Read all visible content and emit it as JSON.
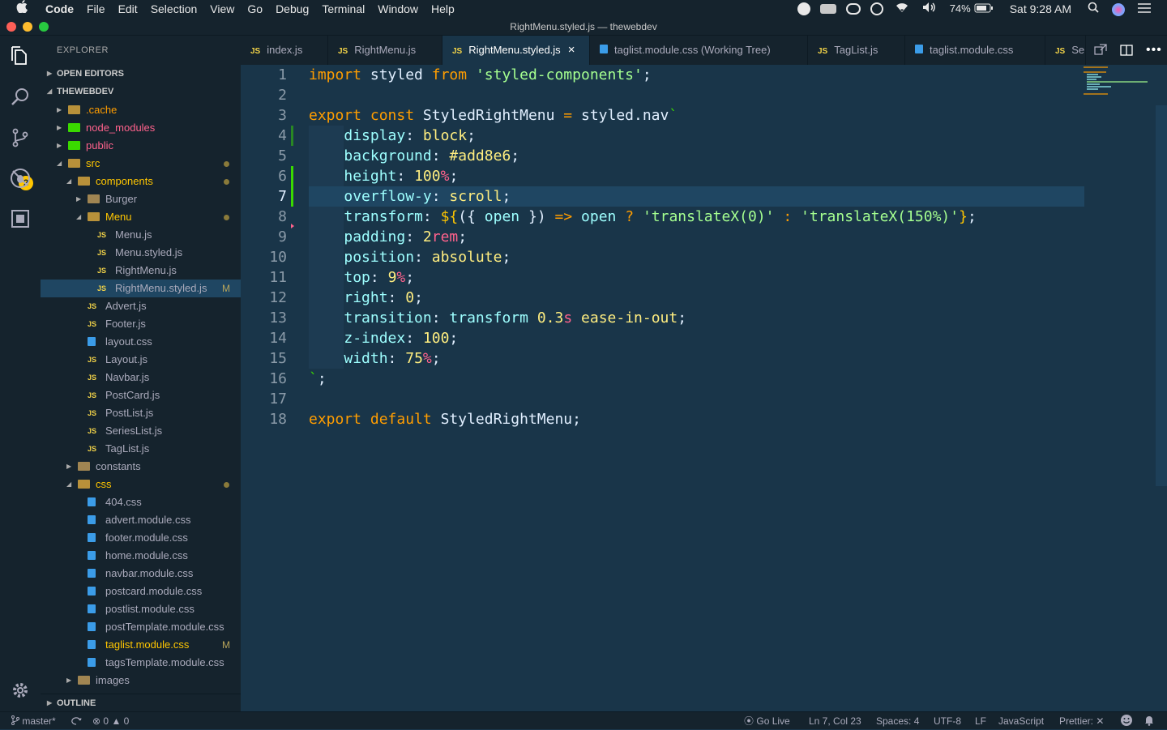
{
  "menubar": {
    "apple": "",
    "app": "Code",
    "items": [
      "File",
      "Edit",
      "Selection",
      "View",
      "Go",
      "Debug",
      "Terminal",
      "Window",
      "Help"
    ],
    "battery": "74%",
    "clock": "Sat 9:28 AM"
  },
  "window": {
    "title": "RightMenu.styled.js — thewebdev"
  },
  "activity": {
    "scm_badge": "2"
  },
  "sidebar": {
    "header": "EXPLORER",
    "open_editors": "OPEN EDITORS",
    "project": "THEWEBDEV",
    "outline": "OUTLINE",
    "tree": [
      {
        "name": ".cache",
        "kind": "folder",
        "color": "#ff9d00"
      },
      {
        "name": "node_modules",
        "kind": "folder",
        "color": "#ff628c"
      },
      {
        "name": "public",
        "kind": "folder",
        "color": "#ff628c"
      },
      {
        "name": "src",
        "kind": "folder",
        "color": "#ffc600"
      },
      {
        "name": "components",
        "kind": "folder",
        "color": "#ffc600"
      },
      {
        "name": "Burger",
        "kind": "folder",
        "color": "#aab"
      },
      {
        "name": "Menu",
        "kind": "folder",
        "color": "#ffc600"
      },
      {
        "name": "Menu.js",
        "kind": "js"
      },
      {
        "name": "Menu.styled.js",
        "kind": "js"
      },
      {
        "name": "RightMenu.js",
        "kind": "js"
      },
      {
        "name": "RightMenu.styled.js",
        "kind": "js",
        "modified": "M"
      },
      {
        "name": "Advert.js",
        "kind": "js"
      },
      {
        "name": "Footer.js",
        "kind": "js"
      },
      {
        "name": "layout.css",
        "kind": "css"
      },
      {
        "name": "Layout.js",
        "kind": "js"
      },
      {
        "name": "Navbar.js",
        "kind": "js"
      },
      {
        "name": "PostCard.js",
        "kind": "js"
      },
      {
        "name": "PostList.js",
        "kind": "js"
      },
      {
        "name": "SeriesList.js",
        "kind": "js"
      },
      {
        "name": "TagList.js",
        "kind": "js"
      },
      {
        "name": "constants",
        "kind": "folder"
      },
      {
        "name": "css",
        "kind": "folder",
        "color": "#ffc600"
      },
      {
        "name": "404.css",
        "kind": "css"
      },
      {
        "name": "advert.module.css",
        "kind": "css"
      },
      {
        "name": "footer.module.css",
        "kind": "css"
      },
      {
        "name": "home.module.css",
        "kind": "css"
      },
      {
        "name": "navbar.module.css",
        "kind": "css"
      },
      {
        "name": "postcard.module.css",
        "kind": "css"
      },
      {
        "name": "postlist.module.css",
        "kind": "css"
      },
      {
        "name": "postTemplate.module.css",
        "kind": "css"
      },
      {
        "name": "taglist.module.css",
        "kind": "css",
        "modified": "M",
        "color": "#ffc600"
      },
      {
        "name": "tagsTemplate.module.css",
        "kind": "css"
      },
      {
        "name": "images",
        "kind": "folder"
      }
    ]
  },
  "tabs": [
    {
      "label": "index.js",
      "icon": "JS"
    },
    {
      "label": "RightMenu.js",
      "icon": "JS"
    },
    {
      "label": "RightMenu.styled.js",
      "icon": "JS",
      "close": "×"
    },
    {
      "label": "taglist.module.css (Working Tree)",
      "icon": "css"
    },
    {
      "label": "TagList.js",
      "icon": "JS"
    },
    {
      "label": "taglist.module.css",
      "icon": "css"
    },
    {
      "label": "Se",
      "icon": "JS"
    }
  ],
  "code": {
    "line_numbers": [
      "1",
      "2",
      "3",
      "4",
      "5",
      "6",
      "7",
      "8",
      "9",
      "10",
      "11",
      "12",
      "13",
      "14",
      "15",
      "16",
      "17",
      "18"
    ]
  },
  "status": {
    "branch": "master*",
    "errors": "0",
    "warnings": "0",
    "go_live": "Go Live",
    "position": "Ln 7, Col 23",
    "spaces": "Spaces: 4",
    "encoding": "UTF-8",
    "eol": "LF",
    "language": "JavaScript",
    "prettier": "Prettier: ✕"
  }
}
